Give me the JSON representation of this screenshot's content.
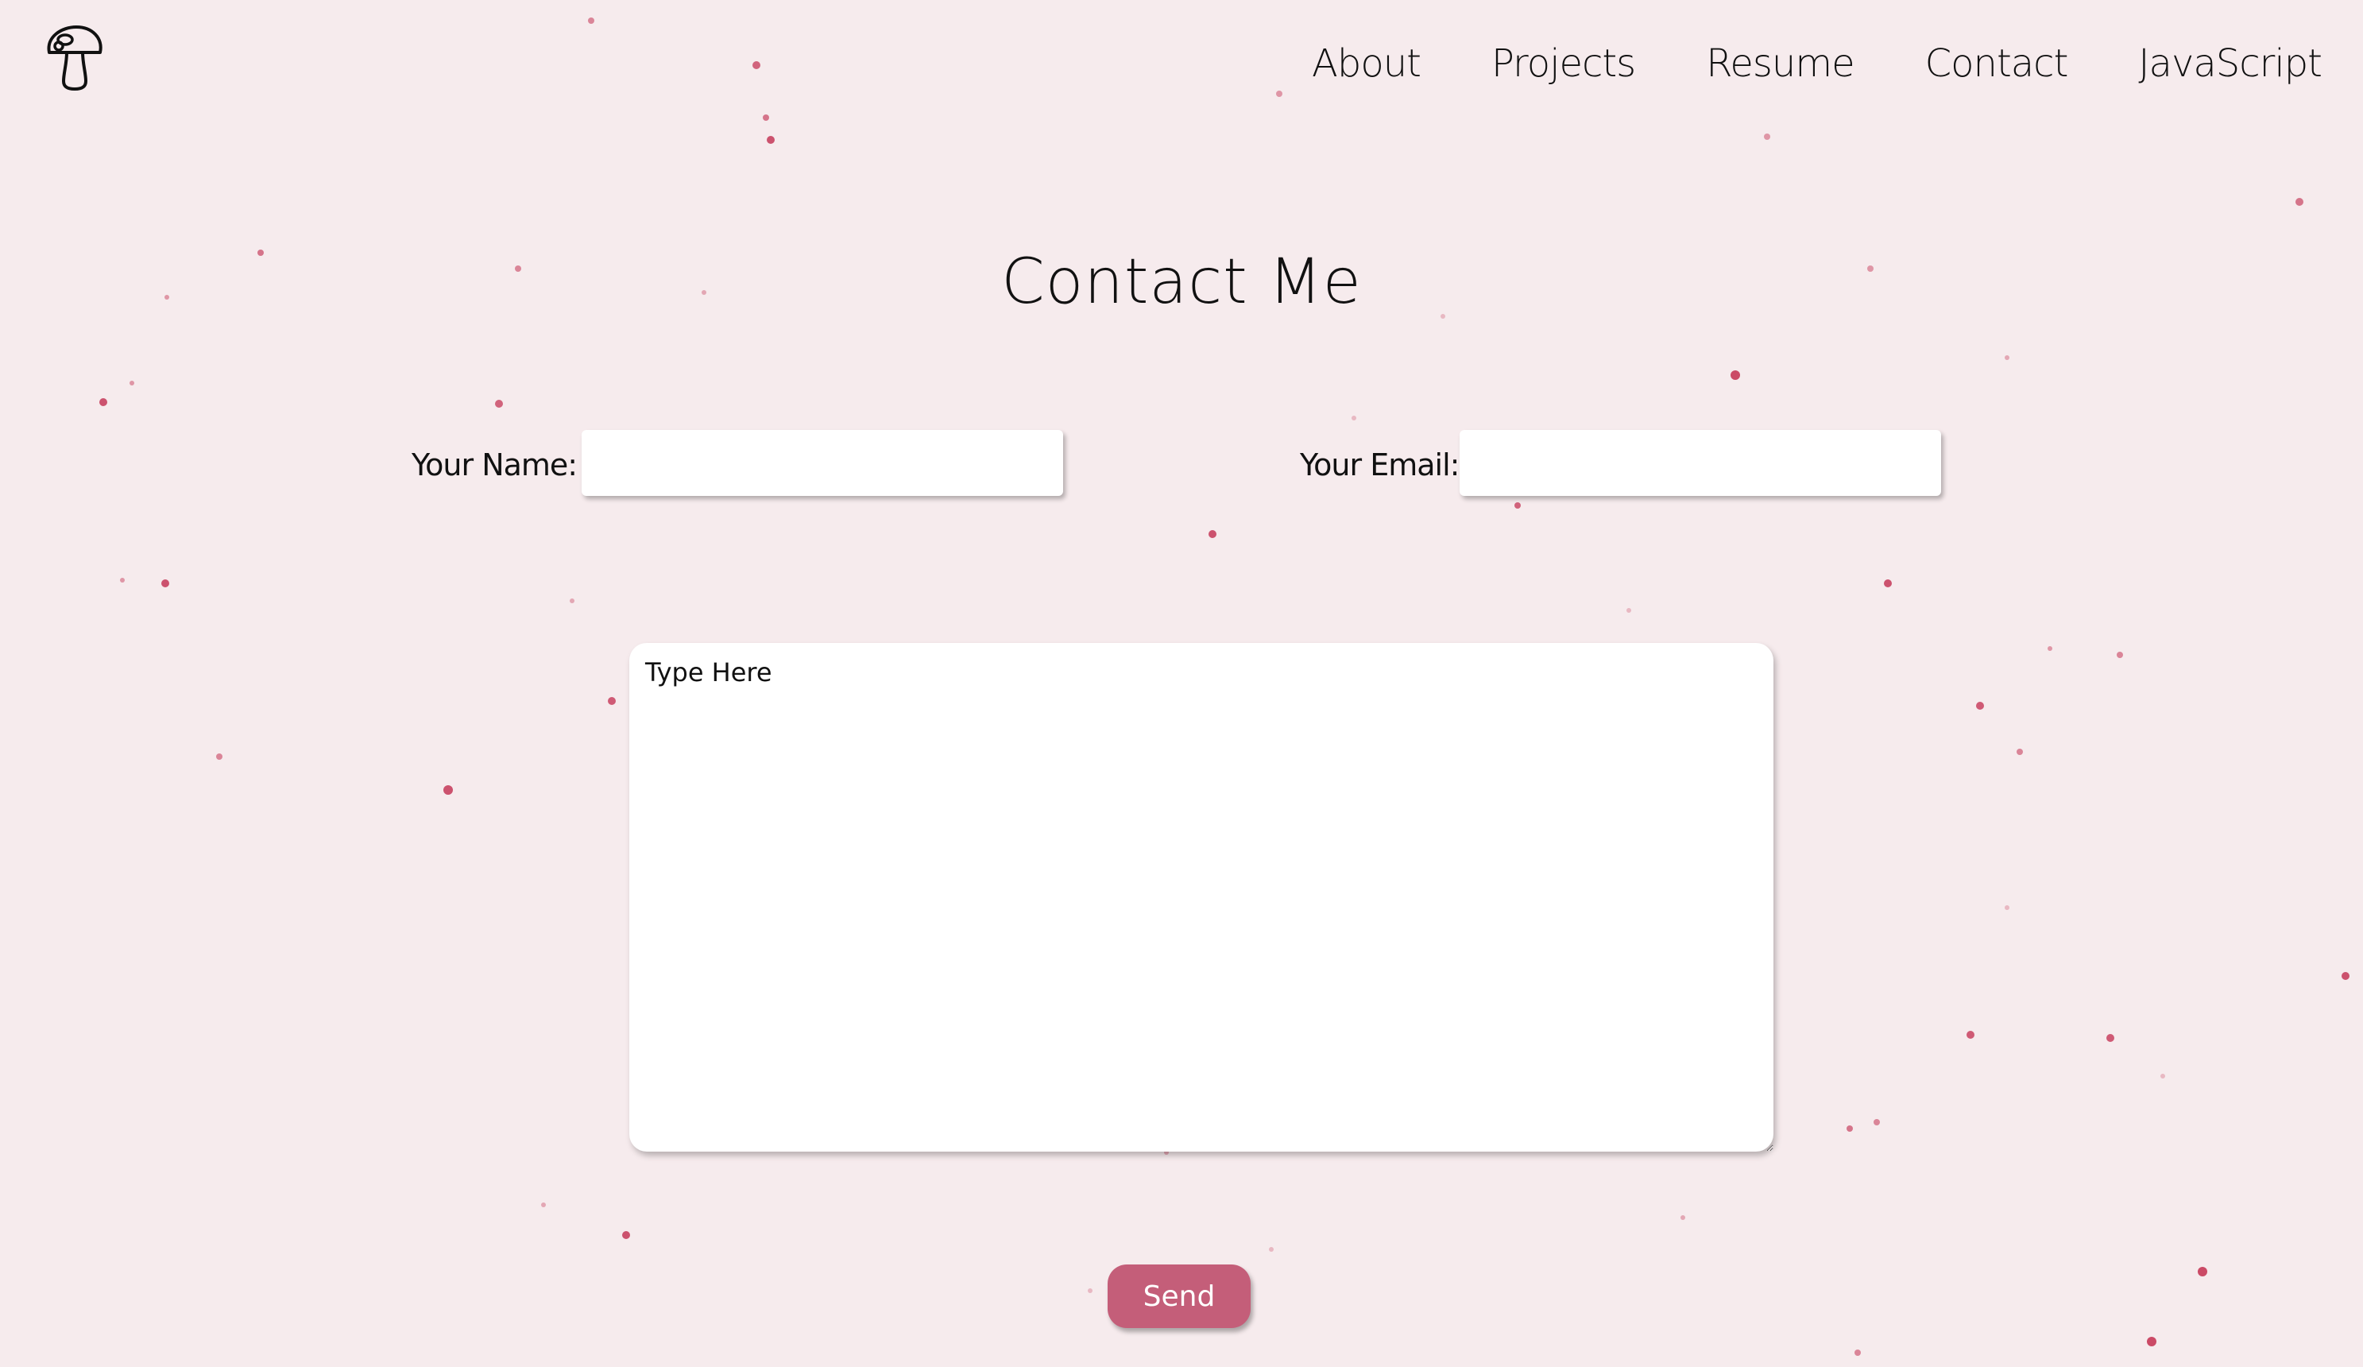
{
  "logo": {
    "icon": "mushroom-icon"
  },
  "nav": {
    "items": [
      {
        "label": "About"
      },
      {
        "label": "Projects"
      },
      {
        "label": "Resume"
      },
      {
        "label": "Contact"
      },
      {
        "label": "JavaScript"
      }
    ]
  },
  "page": {
    "title": "Contact Me"
  },
  "form": {
    "name_label": "Your Name:",
    "name_value": "",
    "email_label": "Your Email:",
    "email_value": "",
    "message_placeholder": "Type Here",
    "send_label": "Send"
  },
  "colors": {
    "background": "#f6ebed",
    "accent": "#c45e79",
    "dots": "#c8415f"
  }
}
